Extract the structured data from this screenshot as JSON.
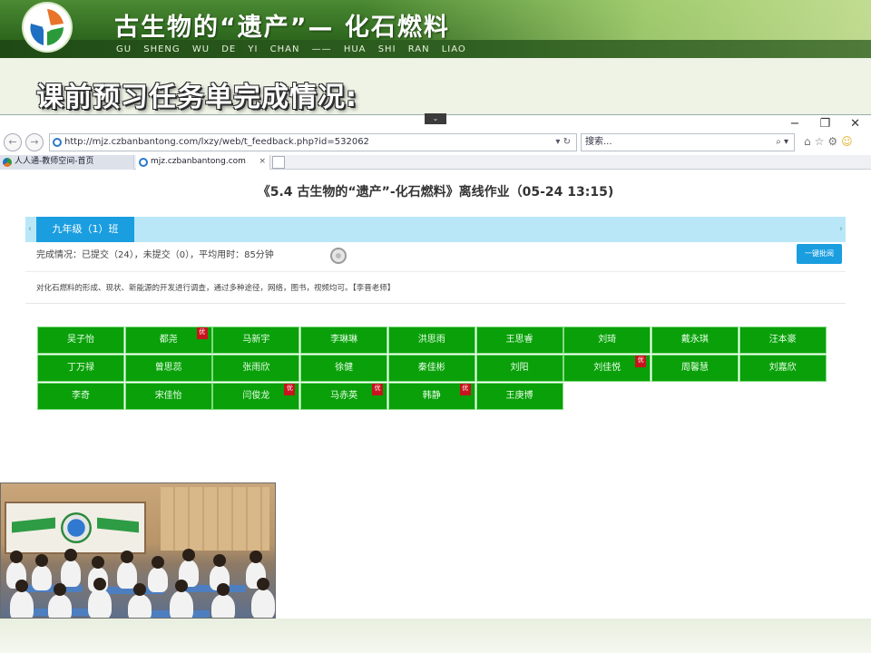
{
  "slide": {
    "title": "古生物的“遗产”— 化石燃料",
    "pinyin": "GU SHENG WU DE YI CHAN —— HUA SHI RAN LIAO",
    "heading": "课前预习任务单完成情况:"
  },
  "browser": {
    "url": "http://mjz.czbanbantong.com/lxzy/web/t_feedback.php?id=532062",
    "search_placeholder": "搜索...",
    "window_controls": [
      "−",
      "❐",
      "✕"
    ],
    "tabs": [
      {
        "label": "人人通-教师空间-首页"
      },
      {
        "label": "mjz.czbanbantong.com"
      }
    ],
    "tab_close": "×"
  },
  "page": {
    "title": "《5.4 古生物的“遗产”-化石燃料》离线作业（05-24 13:15)",
    "class_tab": "九年级（1）班",
    "status": "完成情况：已提交（24），未提交（0），平均用时：85分钟",
    "review_button": "一键批阅",
    "description": "对化石燃料的形成、现状、新能源的开发进行调查，通过多种途径，网络，图书，视频均可。【李晋老师】",
    "mark_label": "优"
  },
  "students": [
    {
      "name": "吴子怡",
      "marked": false
    },
    {
      "name": "都尧",
      "marked": true
    },
    {
      "name": "马新宇",
      "marked": false
    },
    {
      "name": "李琳琳",
      "marked": false
    },
    {
      "name": "洪思雨",
      "marked": false
    },
    {
      "name": "王思睿",
      "marked": false
    },
    {
      "name": "刘琦",
      "marked": false
    },
    {
      "name": "戴永琪",
      "marked": false
    },
    {
      "name": "汪本豪",
      "marked": false
    },
    {
      "name": "丁万禄",
      "marked": false
    },
    {
      "name": "曾思蕊",
      "marked": false
    },
    {
      "name": "张雨欣",
      "marked": false
    },
    {
      "name": "徐健",
      "marked": false
    },
    {
      "name": "秦佳彬",
      "marked": false
    },
    {
      "name": "刘阳",
      "marked": false
    },
    {
      "name": "刘佳悦",
      "marked": true
    },
    {
      "name": "周馨慧",
      "marked": false
    },
    {
      "name": "刘嘉欣",
      "marked": false
    },
    {
      "name": "李奇",
      "marked": false
    },
    {
      "name": "宋佳怡",
      "marked": false
    },
    {
      "name": "闫俊龙",
      "marked": true
    },
    {
      "name": "马赤英",
      "marked": true
    },
    {
      "name": "韩静",
      "marked": true
    },
    {
      "name": "王庚博",
      "marked": false
    }
  ],
  "colors": {
    "banner_green": "#2f6a1f",
    "student_cell": "#0aa00a",
    "accent_blue": "#1a9ee0",
    "class_bar": "#b9e7f8",
    "mark_red": "#c8141e"
  }
}
